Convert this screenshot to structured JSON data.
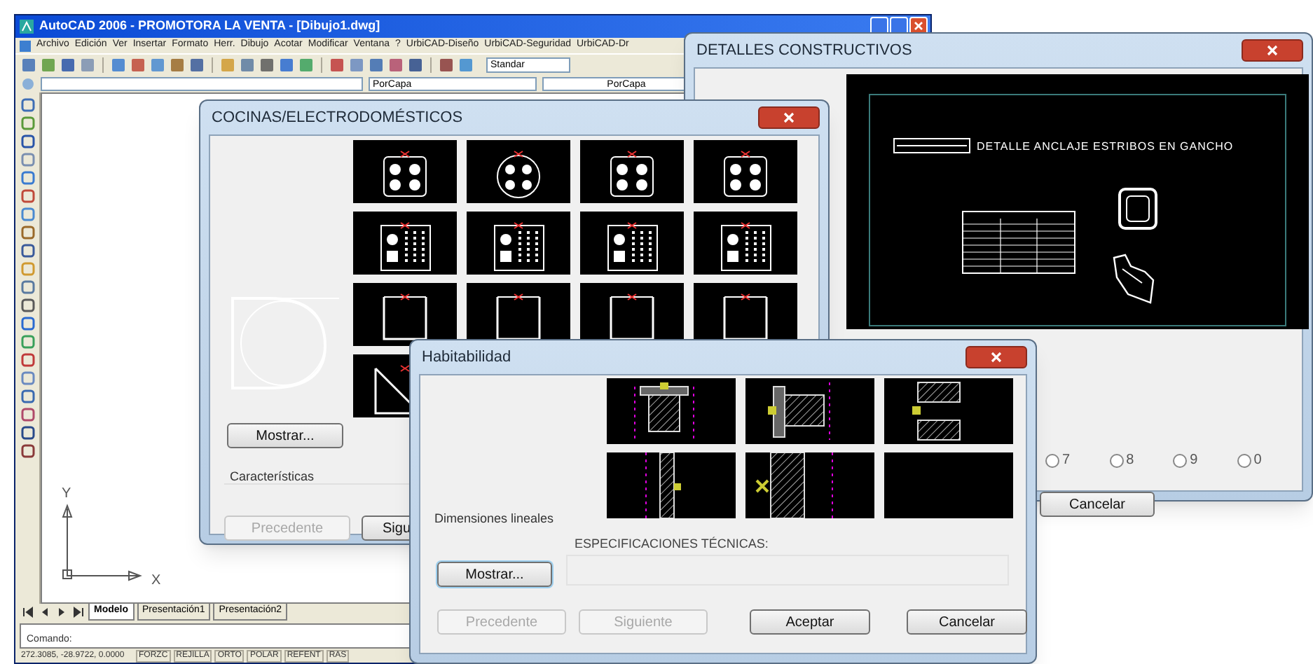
{
  "main_window": {
    "title": "AutoCAD 2006 - PROMOTORA LA VENTA - [Dibujo1.dwg]",
    "menu": [
      "Archivo",
      "Edición",
      "Ver",
      "Insertar",
      "Formato",
      "Herr.",
      "Dibujo",
      "Acotar",
      "Modificar",
      "Ventana",
      "?",
      "UrbiCAD-Diseño",
      "UrbiCAD-Seguridad",
      "UrbiCAD-Dr"
    ],
    "style_field": "Standar",
    "color_field": "PorCapa",
    "linetype_field": "PorCapa",
    "axis_labels": [
      "Y",
      "X"
    ],
    "layout_tabs": [
      {
        "label": "Modelo",
        "selected": true
      },
      {
        "label": "Presentación1",
        "selected": false
      },
      {
        "label": "Presentación2",
        "selected": false
      }
    ],
    "command_prompt": "Comando:",
    "coordinates": "272.3085, -28.9722, 0.0000",
    "status_modes": [
      "FORZC",
      "REJILLA",
      "ORTO",
      "POLAR",
      "REFENT",
      "RAS"
    ]
  },
  "detalles_window": {
    "title": "DETALLES CONSTRUCTIVOS",
    "preview_caption": "DETALLE ANCLAJE ESTRIBOS EN GANCHO",
    "radio_options": [
      {
        "label": "7",
        "selected": false
      },
      {
        "label": "8",
        "selected": false
      },
      {
        "label": "9",
        "selected": false
      },
      {
        "label": "0",
        "selected": false
      }
    ],
    "buttons": [
      "Cancelar"
    ]
  },
  "cocinas_window": {
    "title": "COCINAS/ELECTRODOMÉSTICOS",
    "thumbnails": [
      {
        "kind": "cooktop"
      },
      {
        "kind": "round"
      },
      {
        "kind": "cooktop"
      },
      {
        "kind": "cooktop"
      },
      {
        "kind": "panel"
      },
      {
        "kind": "panel"
      },
      {
        "kind": "panel"
      },
      {
        "kind": "panel"
      },
      {
        "kind": "cabinet"
      },
      {
        "kind": "cabinet"
      },
      {
        "kind": "cabinet"
      },
      {
        "kind": "cabinet"
      },
      {
        "kind": "corner"
      }
    ],
    "show_button": "Mostrar...",
    "features_label": "Características",
    "buttons": [
      {
        "label": "Precedente",
        "disabled": true
      },
      {
        "label": "Sigu",
        "disabled": false
      }
    ]
  },
  "habitabilidad_window": {
    "title": "Habitabilidad",
    "thumbnails": [
      {
        "kind": "plan"
      },
      {
        "kind": "plan"
      },
      {
        "kind": "plan"
      },
      {
        "kind": "plan"
      },
      {
        "kind": "plan"
      },
      {
        "kind": "blank"
      }
    ],
    "caption": "Dimensiones lineales",
    "specs_label": "ESPECIFICACIONES TÉCNICAS:",
    "show_button": "Mostrar...",
    "buttons": [
      {
        "label": "Precedente",
        "disabled": true
      },
      {
        "label": "Siguiente",
        "disabled": true
      },
      {
        "label": "Aceptar",
        "disabled": false
      },
      {
        "label": "Cancelar",
        "disabled": false
      }
    ]
  }
}
